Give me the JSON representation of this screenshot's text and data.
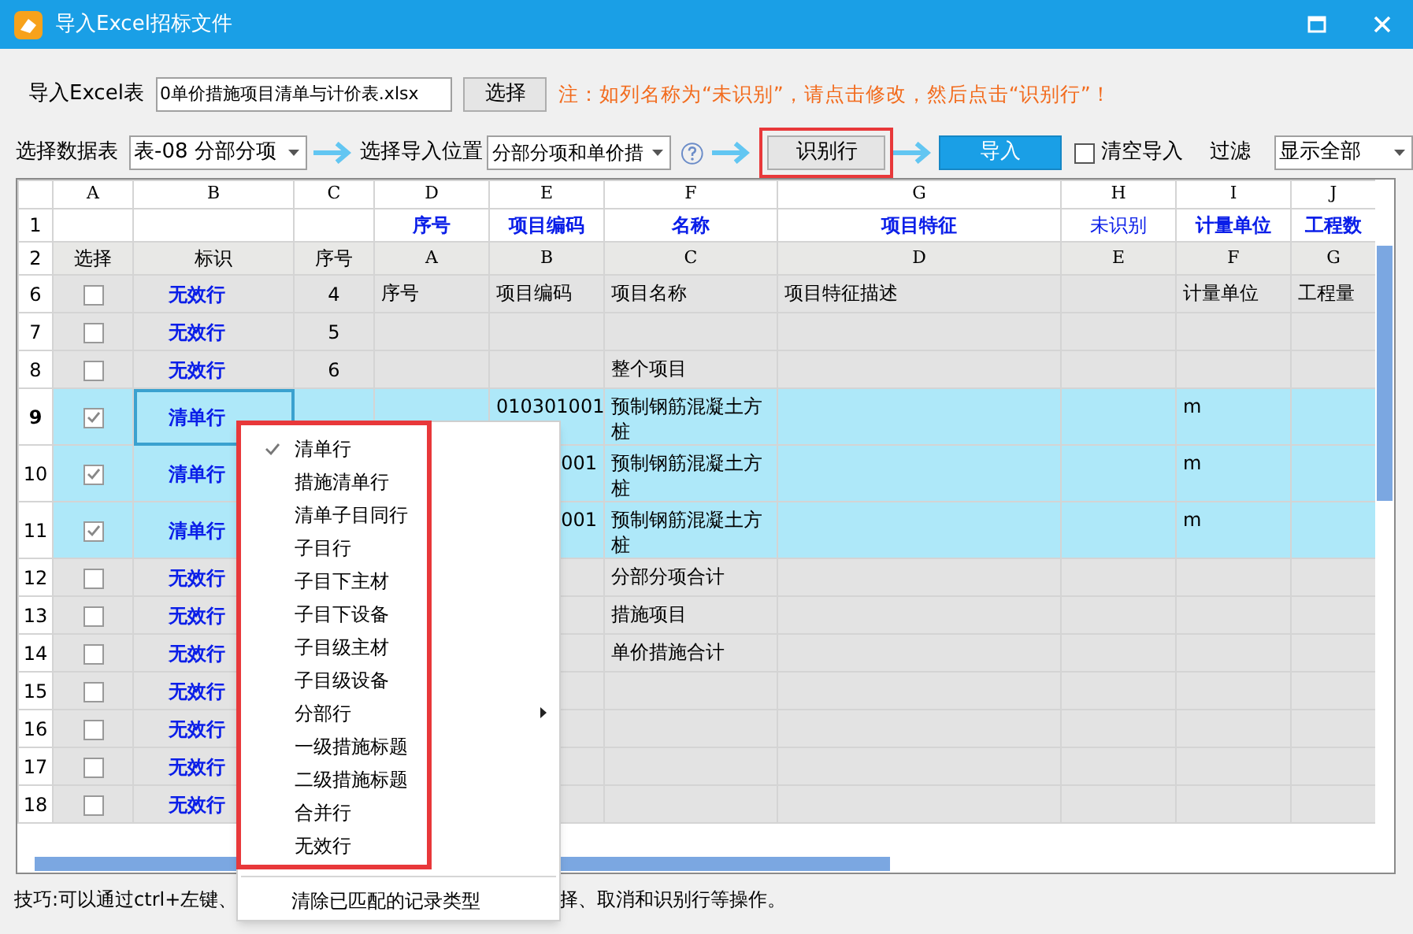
{
  "window": {
    "title": "导入Excel招标文件"
  },
  "file_row": {
    "label": "导入Excel表",
    "file": "0单价措施项目清单与计价表.xlsx",
    "button": "选择",
    "note": "注：如列名称为“未识别”，请点击修改，然后点击“识别行”！"
  },
  "options_row": {
    "sheet_label": "选择数据表",
    "sheet": "表-08 分部分项",
    "position_label": "选择导入位置",
    "position": "分部分项和单价措",
    "recognize_button": "识别行",
    "recognize_highlighted": true,
    "import_button": "导入",
    "clear_import": {
      "label": "清空导入",
      "checked": false
    },
    "filter_label": "过滤",
    "filter": "显示全部"
  },
  "grid": {
    "column_letters": [
      "A",
      "B",
      "C",
      "D",
      "E",
      "F",
      "G",
      "H",
      "I",
      "J"
    ],
    "mapping_row": {
      "num": "1",
      "cells": [
        {},
        {},
        {},
        {
          "text": "序号",
          "recognized": true
        },
        {
          "text": "项目编码",
          "recognized": true
        },
        {
          "text": "名称",
          "recognized": true
        },
        {
          "text": "项目特征",
          "recognized": true
        },
        {
          "text": "未识别",
          "recognized": false
        },
        {
          "text": "计量单位",
          "recognized": true
        },
        {
          "text": "工程数",
          "recognized": true
        }
      ]
    },
    "source_row": {
      "num": "2",
      "cells": [
        "选择",
        "标识",
        "序号",
        "A",
        "B",
        "C",
        "D",
        "E",
        "F",
        "G"
      ]
    },
    "rows": [
      {
        "num": "6",
        "checked": false,
        "selected": false,
        "current": false,
        "mark": "无效行",
        "seq": "4",
        "cells": [
          {
            "text": "序号"
          },
          {
            "text": "项目编码"
          },
          {
            "text": "项目名称"
          },
          {
            "text": "项目特征描述"
          },
          {},
          {
            "text": "计量单位"
          },
          {
            "text": "工程量"
          }
        ]
      },
      {
        "num": "7",
        "checked": false,
        "selected": false,
        "current": false,
        "mark": "无效行",
        "seq": "5",
        "cells": [
          {},
          {},
          {},
          {},
          {},
          {},
          {}
        ]
      },
      {
        "num": "8",
        "checked": false,
        "selected": false,
        "current": false,
        "mark": "无效行",
        "seq": "6",
        "cells": [
          {},
          {},
          {
            "text": "整个项目"
          },
          {},
          {},
          {},
          {}
        ]
      },
      {
        "num": "9",
        "checked": true,
        "selected": true,
        "current": true,
        "mark": "清单行",
        "cells": [
          {},
          {
            "text": "010301001"
          },
          {
            "text": "预制钢筋混凝土方桩"
          },
          {},
          {},
          {
            "text": "m"
          },
          {}
        ]
      },
      {
        "num": "10",
        "checked": true,
        "selected": true,
        "current": false,
        "mark": "清单行",
        "cells": [
          {},
          {
            "text": "001",
            "cut": true
          },
          {
            "text": "预制钢筋混凝土方桩"
          },
          {},
          {},
          {
            "text": "m"
          },
          {}
        ]
      },
      {
        "num": "11",
        "checked": true,
        "selected": true,
        "current": false,
        "mark": "清单行",
        "cells": [
          {},
          {
            "text": "001",
            "cut": true
          },
          {
            "text": "预制钢筋混凝土方桩"
          },
          {},
          {},
          {
            "text": "m"
          },
          {}
        ]
      },
      {
        "num": "12",
        "checked": false,
        "selected": false,
        "current": false,
        "mark": "无效行",
        "cells": [
          {},
          {},
          {
            "text": "分部分项合计"
          },
          {},
          {},
          {},
          {}
        ]
      },
      {
        "num": "13",
        "checked": false,
        "selected": false,
        "current": false,
        "mark": "无效行",
        "cells": [
          {},
          {},
          {
            "text": "措施项目"
          },
          {},
          {},
          {},
          {}
        ]
      },
      {
        "num": "14",
        "checked": false,
        "selected": false,
        "current": false,
        "mark": "无效行",
        "cells": [
          {},
          {},
          {
            "text": "单价措施合计"
          },
          {},
          {},
          {},
          {}
        ]
      },
      {
        "num": "15",
        "checked": false,
        "selected": false,
        "current": false,
        "mark": "无效行",
        "cells": [
          {},
          {},
          {},
          {},
          {},
          {},
          {}
        ]
      },
      {
        "num": "16",
        "checked": false,
        "selected": false,
        "current": false,
        "mark": "无效行",
        "cells": [
          {},
          {},
          {},
          {},
          {},
          {},
          {}
        ]
      },
      {
        "num": "17",
        "checked": false,
        "selected": false,
        "current": false,
        "mark": "无效行",
        "cells": [
          {},
          {},
          {},
          {},
          {},
          {},
          {}
        ]
      },
      {
        "num": "18",
        "checked": false,
        "selected": false,
        "current": false,
        "mark": "无效行",
        "cells": [
          {},
          {},
          {},
          {},
          {},
          {},
          {}
        ]
      }
    ]
  },
  "context_menu": {
    "groups": [
      {
        "highlighted": true,
        "items": [
          {
            "label": "清单行",
            "checked": true
          },
          {
            "label": "措施清单行",
            "checked": false
          },
          {
            "label": "清单子目同行",
            "checked": false
          },
          {
            "label": "子目行",
            "checked": false
          },
          {
            "label": "子目下主材",
            "checked": false
          },
          {
            "label": "子目下设备",
            "checked": false
          },
          {
            "label": "子目级主材",
            "checked": false
          },
          {
            "label": "子目级设备",
            "checked": false
          },
          {
            "label": "分部行",
            "checked": false,
            "submenu": true
          },
          {
            "label": "一级措施标题",
            "checked": false
          },
          {
            "label": "二级措施标题",
            "checked": false
          },
          {
            "label": "合并行",
            "checked": false
          },
          {
            "label": "无效行",
            "checked": false
          }
        ]
      },
      {
        "highlighted": false,
        "items": [
          {
            "label": "清除已匹配的记录类型",
            "checked": false
          }
        ]
      }
    ]
  },
  "tip": "技巧:可以通过ctrl+左键、",
  "tip_tail": "择、取消和识别行等操作。"
}
